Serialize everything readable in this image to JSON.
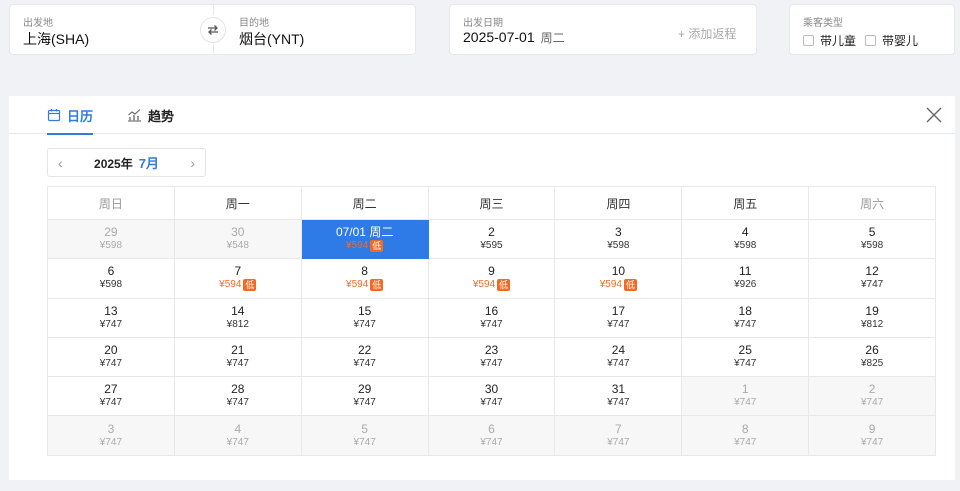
{
  "search": {
    "from_label": "出发地",
    "from_value": "上海(SHA)",
    "to_label": "目的地",
    "to_value": "烟台(YNT)",
    "date_label": "出发日期",
    "date_value": "2025-07-01",
    "date_weekday": "周二",
    "add_return": "+ 添加返程",
    "passenger_label": "乘客类型",
    "child_label": "带儿童",
    "infant_label": "带婴儿"
  },
  "tabs": {
    "calendar": "日历",
    "trend": "趋势"
  },
  "month_nav": {
    "year": "2025年",
    "month": "7月",
    "prev": "‹",
    "next": "›"
  },
  "low_tag": "低",
  "weekdays": [
    "周日",
    "周一",
    "周二",
    "周三",
    "周四",
    "周五",
    "周六"
  ],
  "weeks": [
    [
      {
        "day": "29",
        "price": "¥598",
        "muted": true
      },
      {
        "day": "30",
        "price": "¥548",
        "muted": true
      },
      {
        "day": "07/01 周二",
        "price": "¥594",
        "low": true,
        "selected": true
      },
      {
        "day": "2",
        "price": "¥595"
      },
      {
        "day": "3",
        "price": "¥598"
      },
      {
        "day": "4",
        "price": "¥598"
      },
      {
        "day": "5",
        "price": "¥598"
      }
    ],
    [
      {
        "day": "6",
        "price": "¥598"
      },
      {
        "day": "7",
        "price": "¥594",
        "low": true
      },
      {
        "day": "8",
        "price": "¥594",
        "low": true
      },
      {
        "day": "9",
        "price": "¥594",
        "low": true
      },
      {
        "day": "10",
        "price": "¥594",
        "low": true
      },
      {
        "day": "11",
        "price": "¥926"
      },
      {
        "day": "12",
        "price": "¥747"
      }
    ],
    [
      {
        "day": "13",
        "price": "¥747"
      },
      {
        "day": "14",
        "price": "¥812"
      },
      {
        "day": "15",
        "price": "¥747"
      },
      {
        "day": "16",
        "price": "¥747"
      },
      {
        "day": "17",
        "price": "¥747"
      },
      {
        "day": "18",
        "price": "¥747"
      },
      {
        "day": "19",
        "price": "¥812"
      }
    ],
    [
      {
        "day": "20",
        "price": "¥747"
      },
      {
        "day": "21",
        "price": "¥747"
      },
      {
        "day": "22",
        "price": "¥747"
      },
      {
        "day": "23",
        "price": "¥747"
      },
      {
        "day": "24",
        "price": "¥747"
      },
      {
        "day": "25",
        "price": "¥747"
      },
      {
        "day": "26",
        "price": "¥825"
      }
    ],
    [
      {
        "day": "27",
        "price": "¥747"
      },
      {
        "day": "28",
        "price": "¥747"
      },
      {
        "day": "29",
        "price": "¥747"
      },
      {
        "day": "30",
        "price": "¥747"
      },
      {
        "day": "31",
        "price": "¥747"
      },
      {
        "day": "1",
        "price": "¥747",
        "muted": true
      },
      {
        "day": "2",
        "price": "¥747",
        "muted": true
      }
    ],
    [
      {
        "day": "3",
        "price": "¥747",
        "muted": true
      },
      {
        "day": "4",
        "price": "¥747",
        "muted": true
      },
      {
        "day": "5",
        "price": "¥747",
        "muted": true
      },
      {
        "day": "6",
        "price": "¥747",
        "muted": true
      },
      {
        "day": "7",
        "price": "¥747",
        "muted": true
      },
      {
        "day": "8",
        "price": "¥747",
        "muted": true
      },
      {
        "day": "9",
        "price": "¥747",
        "muted": true
      }
    ]
  ],
  "colors": {
    "accent": "#2e7ae6",
    "low_price": "#f26b21"
  },
  "icons": {
    "swap": "swap-arrows-icon",
    "calendar": "calendar-icon",
    "trend": "trend-chart-icon",
    "close": "close-icon"
  }
}
